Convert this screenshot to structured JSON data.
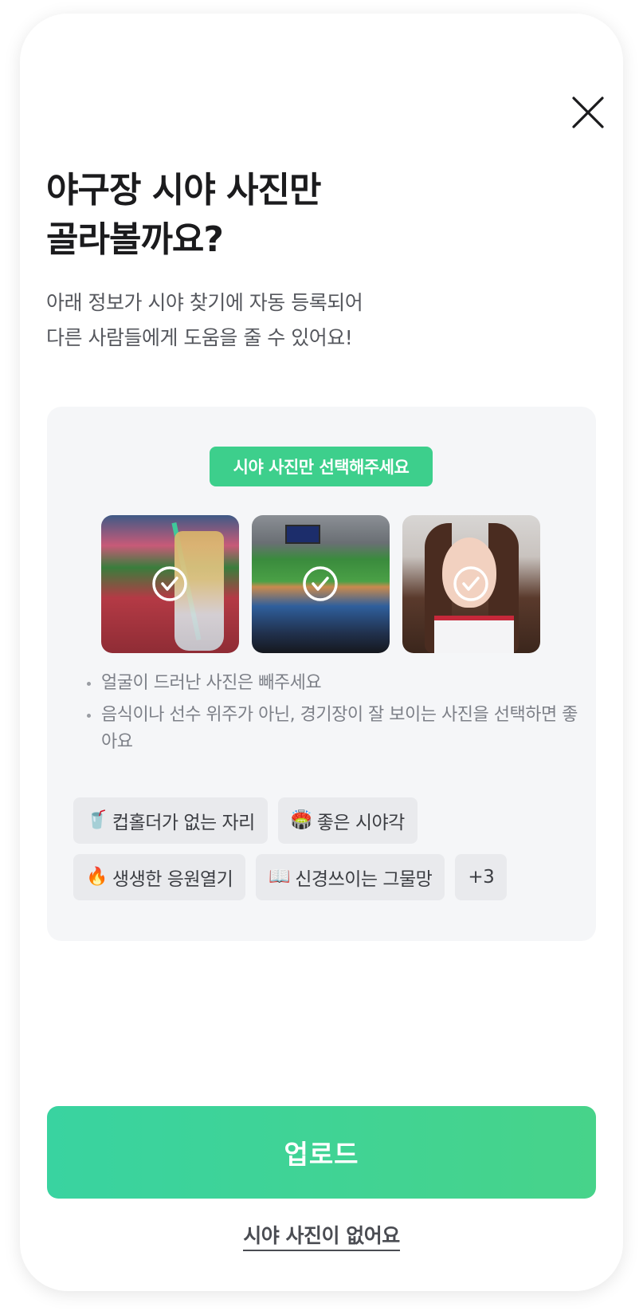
{
  "modal": {
    "title_lines": [
      "야구장 시야 사진만",
      "골라볼까요?"
    ],
    "subtitle_lines": [
      "아래 정보가 시야 찾기에 자동 등록되어",
      "다른 사람들에게 도움을 줄 수 있어요!"
    ]
  },
  "guide": {
    "chip_label": "시야 사진만 선택해주세요",
    "photos": [
      {
        "name": "stadium-drink-photo",
        "checked": true
      },
      {
        "name": "stadium-field-photo",
        "checked": true
      },
      {
        "name": "selfie-photo",
        "checked": true
      }
    ],
    "bullets": [
      "얼굴이 드러난 사진은 빼주세요",
      "음식이나 선수 위주가 아닌, 경기장이 잘 보이는 사진을 선택하면 좋아요"
    ],
    "tags": [
      {
        "emoji": "🥤",
        "label": "컵홀더가 없는 자리"
      },
      {
        "emoji": "🏟️",
        "label": "좋은 시야각"
      },
      {
        "emoji": "🔥",
        "label": "생생한 응원열기"
      },
      {
        "emoji": "📖",
        "label": "신경쓰이는 그물망"
      },
      {
        "emoji": "",
        "label": "+3"
      }
    ]
  },
  "actions": {
    "upload_label": "업로드",
    "no_photo_label": "시야 사진이 없어요"
  },
  "colors": {
    "accent": "#3dcf8c",
    "guide_bg": "#f5f6f8",
    "tag_bg": "#e9eaed"
  }
}
